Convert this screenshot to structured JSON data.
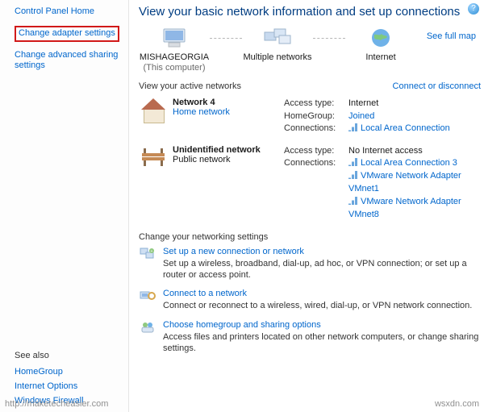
{
  "sidebar": {
    "home": "Control Panel Home",
    "change_adapter": "Change adapter settings",
    "change_advanced": "Change advanced sharing settings",
    "see_also_heading": "See also",
    "see_also": {
      "homegroup": "HomeGroup",
      "internet_options": "Internet Options",
      "windows_firewall": "Windows Firewall"
    }
  },
  "main": {
    "title": "View your basic network information and set up connections",
    "see_full_map": "See full map",
    "nodes": {
      "computer": {
        "label": "MISHAGEORGIA",
        "sub": "(This computer)"
      },
      "multi": {
        "label": "Multiple networks",
        "sub": ""
      },
      "internet": {
        "label": "Internet",
        "sub": ""
      }
    },
    "active_hdr": "View your active networks",
    "connect_disc": "Connect or disconnect",
    "nets": [
      {
        "name": "Network  4",
        "sub": "Home network",
        "rows": [
          {
            "k": "Access type:",
            "v": "Internet",
            "link": false
          },
          {
            "k": "HomeGroup:",
            "v": "Joined",
            "link": true
          }
        ],
        "conn_label": "Connections:",
        "conns": [
          "Local Area Connection"
        ]
      },
      {
        "name": "Unidentified network",
        "sub": "Public network",
        "rows": [
          {
            "k": "Access type:",
            "v": "No Internet access",
            "link": false
          }
        ],
        "conn_label": "Connections:",
        "conns": [
          "Local Area Connection 3",
          "VMware Network Adapter VMnet1",
          "VMware Network Adapter VMnet8"
        ]
      }
    ],
    "tasks_heading": "Change your networking settings",
    "tasks": [
      {
        "title": "Set up a new connection or network",
        "desc": "Set up a wireless, broadband, dial-up, ad hoc, or VPN connection; or set up a router or access point."
      },
      {
        "title": "Connect to a network",
        "desc": "Connect or reconnect to a wireless, wired, dial-up, or VPN network connection."
      },
      {
        "title": "Choose homegroup and sharing options",
        "desc": "Access files and printers located on other network computers, or change sharing settings."
      }
    ]
  },
  "watermark_left": "http://maketecheasier.com",
  "watermark_right": "wsxdn.com"
}
